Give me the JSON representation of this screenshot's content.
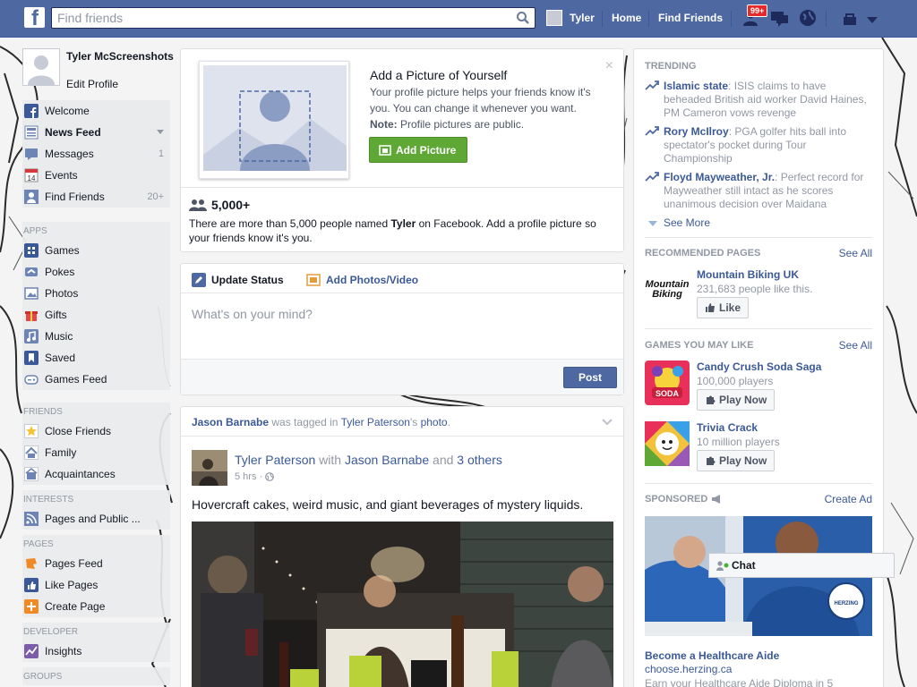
{
  "topbar": {
    "logo_letter": "f",
    "search_placeholder": "Find friends",
    "user_name": "Tyler",
    "home": "Home",
    "find_friends": "Find Friends",
    "notif_badge": "99+"
  },
  "profile": {
    "name": "Tyler McScreenshots",
    "edit": "Edit Profile"
  },
  "nav": {
    "main": [
      {
        "label": "Welcome",
        "count": "",
        "icon": "facebook-icon"
      },
      {
        "label": "News Feed",
        "count": "",
        "icon": "news-feed-icon"
      },
      {
        "label": "Messages",
        "count": "1",
        "icon": "messages-icon"
      },
      {
        "label": "Events",
        "count": "",
        "icon": "calendar-icon",
        "icon_text": "14"
      },
      {
        "label": "Find Friends",
        "count": "20+",
        "icon": "find-friends-icon"
      }
    ],
    "apps_title": "APPS",
    "apps": [
      {
        "label": "Games",
        "icon": "games-icon"
      },
      {
        "label": "Pokes",
        "icon": "pokes-icon"
      },
      {
        "label": "Photos",
        "icon": "photos-icon"
      },
      {
        "label": "Gifts",
        "icon": "gifts-icon"
      },
      {
        "label": "Music",
        "icon": "music-icon"
      },
      {
        "label": "Saved",
        "icon": "saved-icon"
      },
      {
        "label": "Games Feed",
        "icon": "games-feed-icon"
      }
    ],
    "friends_title": "FRIENDS",
    "friends": [
      {
        "label": "Close Friends",
        "icon": "star-icon"
      },
      {
        "label": "Family",
        "icon": "family-icon"
      },
      {
        "label": "Acquaintances",
        "icon": "acquaintances-icon"
      }
    ],
    "interests_title": "INTERESTS",
    "interests": [
      {
        "label": "Pages and Public ...",
        "icon": "rss-icon"
      }
    ],
    "pages_title": "PAGES",
    "pages": [
      {
        "label": "Pages Feed",
        "icon": "pages-feed-icon"
      },
      {
        "label": "Like Pages",
        "icon": "like-pages-icon"
      },
      {
        "label": "Create Page",
        "icon": "create-page-icon"
      }
    ],
    "developer_title": "DEVELOPER",
    "developer": [
      {
        "label": "Insights",
        "icon": "insights-icon"
      }
    ],
    "groups_title": "GROUPS"
  },
  "profile_prompt": {
    "title": "Add a Picture of Yourself",
    "text": "Your profile picture helps your friends know it's you. You can change it whenever you want.",
    "note_label": "Note:",
    "note_text": " Profile pictures are public.",
    "button": "Add Picture",
    "close": "×",
    "count": "5,000+",
    "desc_pre": "There are more than 5,000 people named ",
    "desc_name": "Tyler",
    "desc_post": " on Facebook. Add a profile picture so your friends know it's you."
  },
  "composer": {
    "tab_status": "Update Status",
    "tab_photos": "Add Photos/Video",
    "placeholder": "What's on your mind?",
    "post": "Post"
  },
  "story": {
    "head_actor": "Jason Barnabe",
    "head_mid": " was tagged in ",
    "head_owner": "Tyler Paterson",
    "head_s": "'s ",
    "head_obj": "photo",
    "head_end": ".",
    "author": "Tyler Paterson",
    "with": " with ",
    "tagged": "Jason Barnabe",
    "and": " and ",
    "others": "3 others",
    "time": "5 hrs · ",
    "text": "Hovercraft cakes, weird music, and giant beverages of mystery liquids."
  },
  "trending": {
    "title": "TRENDING",
    "items": [
      {
        "topic": "Islamic state",
        "desc": ": ISIS claims to have beheaded British aid worker David Haines, PM Cameron vows revenge"
      },
      {
        "topic": "Rory McIlroy",
        "desc": ": PGA golfer hits ball into spectator's pocket during Tour Championship"
      },
      {
        "topic": "Floyd Mayweather, Jr.",
        "desc": ": Perfect record for Mayweather still intact as he scores unanimous decision over Maidana"
      }
    ],
    "see_more": "See More"
  },
  "recommended": {
    "title": "RECOMMENDED PAGES",
    "see_all": "See All",
    "name": "Mountain Biking UK",
    "likes": "231,683 people like this.",
    "logo_text": "Mountain Biking",
    "button": "Like"
  },
  "games": {
    "title": "GAMES YOU MAY LIKE",
    "see_all": "See All",
    "items": [
      {
        "name": "Candy Crush Soda Saga",
        "players": "100,000 players",
        "button": "Play Now",
        "logo_text": "SODA"
      },
      {
        "name": "Trivia Crack",
        "players": "10 million players",
        "button": "Play Now"
      }
    ]
  },
  "sponsored": {
    "title": "SPONSORED",
    "create": "Create Ad",
    "ad_title": "Become a Healthcare Aide",
    "ad_url": "choose.herzing.ca",
    "ad_text": "Earn your Healthcare Aide Diploma in 5",
    "badge_text": "HERZING"
  },
  "chat": {
    "label": "Chat"
  },
  "colors": {
    "brand": "#4e69a2",
    "link": "#3b5998",
    "green": "#5fa836"
  }
}
